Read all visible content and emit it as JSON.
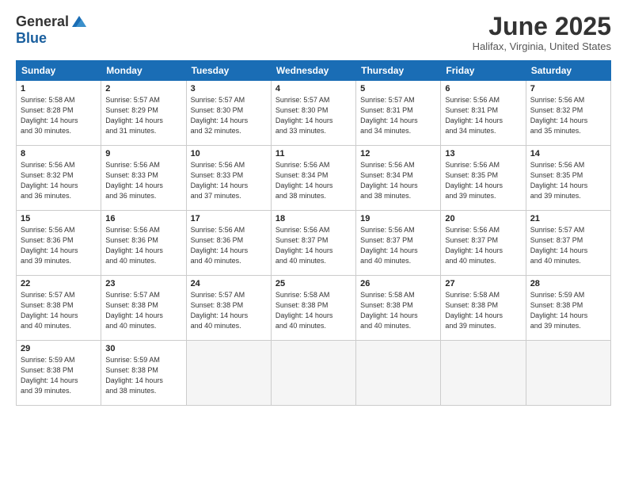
{
  "header": {
    "logo_general": "General",
    "logo_blue": "Blue",
    "month_year": "June 2025",
    "location": "Halifax, Virginia, United States"
  },
  "days_of_week": [
    "Sunday",
    "Monday",
    "Tuesday",
    "Wednesday",
    "Thursday",
    "Friday",
    "Saturday"
  ],
  "weeks": [
    [
      {
        "day": "1",
        "info": "Sunrise: 5:58 AM\nSunset: 8:28 PM\nDaylight: 14 hours\nand 30 minutes."
      },
      {
        "day": "2",
        "info": "Sunrise: 5:57 AM\nSunset: 8:29 PM\nDaylight: 14 hours\nand 31 minutes."
      },
      {
        "day": "3",
        "info": "Sunrise: 5:57 AM\nSunset: 8:30 PM\nDaylight: 14 hours\nand 32 minutes."
      },
      {
        "day": "4",
        "info": "Sunrise: 5:57 AM\nSunset: 8:30 PM\nDaylight: 14 hours\nand 33 minutes."
      },
      {
        "day": "5",
        "info": "Sunrise: 5:57 AM\nSunset: 8:31 PM\nDaylight: 14 hours\nand 34 minutes."
      },
      {
        "day": "6",
        "info": "Sunrise: 5:56 AM\nSunset: 8:31 PM\nDaylight: 14 hours\nand 34 minutes."
      },
      {
        "day": "7",
        "info": "Sunrise: 5:56 AM\nSunset: 8:32 PM\nDaylight: 14 hours\nand 35 minutes."
      }
    ],
    [
      {
        "day": "8",
        "info": "Sunrise: 5:56 AM\nSunset: 8:32 PM\nDaylight: 14 hours\nand 36 minutes."
      },
      {
        "day": "9",
        "info": "Sunrise: 5:56 AM\nSunset: 8:33 PM\nDaylight: 14 hours\nand 36 minutes."
      },
      {
        "day": "10",
        "info": "Sunrise: 5:56 AM\nSunset: 8:33 PM\nDaylight: 14 hours\nand 37 minutes."
      },
      {
        "day": "11",
        "info": "Sunrise: 5:56 AM\nSunset: 8:34 PM\nDaylight: 14 hours\nand 38 minutes."
      },
      {
        "day": "12",
        "info": "Sunrise: 5:56 AM\nSunset: 8:34 PM\nDaylight: 14 hours\nand 38 minutes."
      },
      {
        "day": "13",
        "info": "Sunrise: 5:56 AM\nSunset: 8:35 PM\nDaylight: 14 hours\nand 39 minutes."
      },
      {
        "day": "14",
        "info": "Sunrise: 5:56 AM\nSunset: 8:35 PM\nDaylight: 14 hours\nand 39 minutes."
      }
    ],
    [
      {
        "day": "15",
        "info": "Sunrise: 5:56 AM\nSunset: 8:36 PM\nDaylight: 14 hours\nand 39 minutes."
      },
      {
        "day": "16",
        "info": "Sunrise: 5:56 AM\nSunset: 8:36 PM\nDaylight: 14 hours\nand 40 minutes."
      },
      {
        "day": "17",
        "info": "Sunrise: 5:56 AM\nSunset: 8:36 PM\nDaylight: 14 hours\nand 40 minutes."
      },
      {
        "day": "18",
        "info": "Sunrise: 5:56 AM\nSunset: 8:37 PM\nDaylight: 14 hours\nand 40 minutes."
      },
      {
        "day": "19",
        "info": "Sunrise: 5:56 AM\nSunset: 8:37 PM\nDaylight: 14 hours\nand 40 minutes."
      },
      {
        "day": "20",
        "info": "Sunrise: 5:56 AM\nSunset: 8:37 PM\nDaylight: 14 hours\nand 40 minutes."
      },
      {
        "day": "21",
        "info": "Sunrise: 5:57 AM\nSunset: 8:37 PM\nDaylight: 14 hours\nand 40 minutes."
      }
    ],
    [
      {
        "day": "22",
        "info": "Sunrise: 5:57 AM\nSunset: 8:38 PM\nDaylight: 14 hours\nand 40 minutes."
      },
      {
        "day": "23",
        "info": "Sunrise: 5:57 AM\nSunset: 8:38 PM\nDaylight: 14 hours\nand 40 minutes."
      },
      {
        "day": "24",
        "info": "Sunrise: 5:57 AM\nSunset: 8:38 PM\nDaylight: 14 hours\nand 40 minutes."
      },
      {
        "day": "25",
        "info": "Sunrise: 5:58 AM\nSunset: 8:38 PM\nDaylight: 14 hours\nand 40 minutes."
      },
      {
        "day": "26",
        "info": "Sunrise: 5:58 AM\nSunset: 8:38 PM\nDaylight: 14 hours\nand 40 minutes."
      },
      {
        "day": "27",
        "info": "Sunrise: 5:58 AM\nSunset: 8:38 PM\nDaylight: 14 hours\nand 39 minutes."
      },
      {
        "day": "28",
        "info": "Sunrise: 5:59 AM\nSunset: 8:38 PM\nDaylight: 14 hours\nand 39 minutes."
      }
    ],
    [
      {
        "day": "29",
        "info": "Sunrise: 5:59 AM\nSunset: 8:38 PM\nDaylight: 14 hours\nand 39 minutes."
      },
      {
        "day": "30",
        "info": "Sunrise: 5:59 AM\nSunset: 8:38 PM\nDaylight: 14 hours\nand 38 minutes."
      },
      {
        "day": "",
        "info": ""
      },
      {
        "day": "",
        "info": ""
      },
      {
        "day": "",
        "info": ""
      },
      {
        "day": "",
        "info": ""
      },
      {
        "day": "",
        "info": ""
      }
    ]
  ]
}
